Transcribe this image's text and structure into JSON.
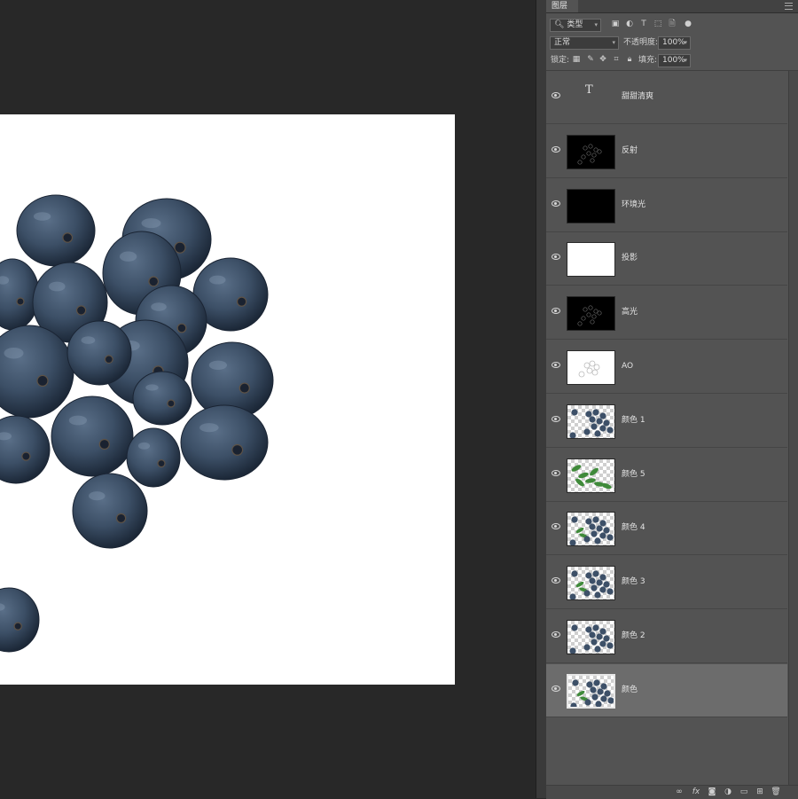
{
  "panel": {
    "tab_label": "图层",
    "filter": {
      "label": "类型",
      "icon": "search-icon"
    },
    "blend_mode": "正常",
    "opacity_label": "不透明度:",
    "opacity_value": "100%",
    "lock_label": "锁定:",
    "fill_label": "填充:",
    "fill_value": "100%"
  },
  "layers": [
    {
      "name": "甜甜清爽",
      "type": "text"
    },
    {
      "name": "反射",
      "type": "dark-dots"
    },
    {
      "name": "环境光",
      "type": "black"
    },
    {
      "name": "投影",
      "type": "white"
    },
    {
      "name": "高光",
      "type": "dark-dots"
    },
    {
      "name": "AO",
      "type": "ao"
    },
    {
      "name": "颜色 1",
      "type": "berries"
    },
    {
      "name": "颜色 5",
      "type": "leaves"
    },
    {
      "name": "颜色 4",
      "type": "berries-leaf"
    },
    {
      "name": "颜色 3",
      "type": "berries-leaf"
    },
    {
      "name": "颜色 2",
      "type": "berries"
    },
    {
      "name": "颜色",
      "type": "berries-leaf",
      "selected": true
    }
  ],
  "colors": {
    "workspace": "#282828",
    "panel": "#535353",
    "berry": "#3d5068",
    "berry_dark": "#1f2c3d",
    "leaf": "#3f8a3a"
  }
}
